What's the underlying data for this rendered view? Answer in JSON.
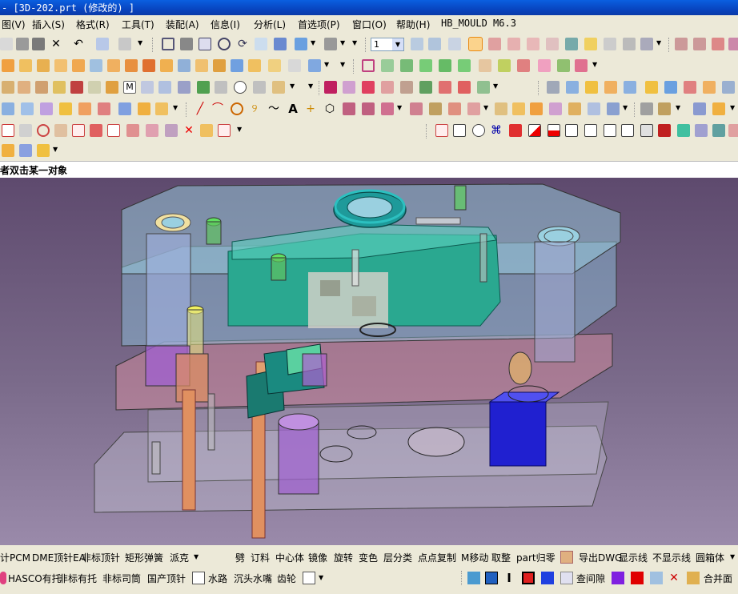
{
  "window": {
    "title": "- [3D-202.prt  (修改的) ]"
  },
  "menu": [
    "图(V)",
    "插入(S)",
    "格式(R)",
    "工具(T)",
    "装配(A)",
    "信息(I)",
    "分析(L)",
    "首选项(P)",
    "窗口(O)",
    "帮助(H)",
    "HB_MOULD M6.3"
  ],
  "toolbar": {
    "layer_combo_value": "1"
  },
  "prompt": {
    "text": "者双击某一对象"
  },
  "bottom_row1": [
    "计PCM",
    "DME顶针EA",
    "非标顶针",
    "矩形弹簧",
    "派克",
    "劈",
    "订料",
    "中心体",
    "镜像",
    "旋转",
    "变色",
    "层分类",
    "点点复制",
    "M移动",
    "取整",
    "part归零",
    "导出DWG",
    "显示线",
    "不显示线",
    "圆箱体"
  ],
  "bottom_row2": [
    "HASCO有托",
    "非标有托",
    "非标司筒",
    "国产顶针",
    "水路",
    "沉头水嘴",
    "齿轮",
    "查间隙",
    "合并面"
  ],
  "colors": {
    "titlebar": "#0a4fd0",
    "viewport_bg": "#6e5e80",
    "plate": "#8fd0dc",
    "cavity": "#2aa890",
    "ring": "#1e9a9a"
  }
}
